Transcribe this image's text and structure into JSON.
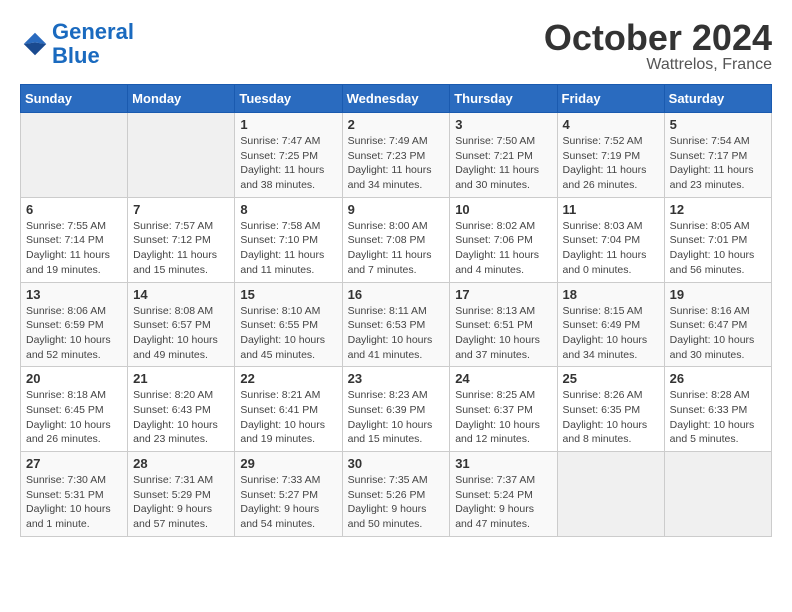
{
  "header": {
    "logo_line1": "General",
    "logo_line2": "Blue",
    "title": "October 2024",
    "subtitle": "Wattrelos, France"
  },
  "days_of_week": [
    "Sunday",
    "Monday",
    "Tuesday",
    "Wednesday",
    "Thursday",
    "Friday",
    "Saturday"
  ],
  "weeks": [
    [
      {
        "day": "",
        "info": ""
      },
      {
        "day": "",
        "info": ""
      },
      {
        "day": "1",
        "info": "Sunrise: 7:47 AM\nSunset: 7:25 PM\nDaylight: 11 hours and 38 minutes."
      },
      {
        "day": "2",
        "info": "Sunrise: 7:49 AM\nSunset: 7:23 PM\nDaylight: 11 hours and 34 minutes."
      },
      {
        "day": "3",
        "info": "Sunrise: 7:50 AM\nSunset: 7:21 PM\nDaylight: 11 hours and 30 minutes."
      },
      {
        "day": "4",
        "info": "Sunrise: 7:52 AM\nSunset: 7:19 PM\nDaylight: 11 hours and 26 minutes."
      },
      {
        "day": "5",
        "info": "Sunrise: 7:54 AM\nSunset: 7:17 PM\nDaylight: 11 hours and 23 minutes."
      }
    ],
    [
      {
        "day": "6",
        "info": "Sunrise: 7:55 AM\nSunset: 7:14 PM\nDaylight: 11 hours and 19 minutes."
      },
      {
        "day": "7",
        "info": "Sunrise: 7:57 AM\nSunset: 7:12 PM\nDaylight: 11 hours and 15 minutes."
      },
      {
        "day": "8",
        "info": "Sunrise: 7:58 AM\nSunset: 7:10 PM\nDaylight: 11 hours and 11 minutes."
      },
      {
        "day": "9",
        "info": "Sunrise: 8:00 AM\nSunset: 7:08 PM\nDaylight: 11 hours and 7 minutes."
      },
      {
        "day": "10",
        "info": "Sunrise: 8:02 AM\nSunset: 7:06 PM\nDaylight: 11 hours and 4 minutes."
      },
      {
        "day": "11",
        "info": "Sunrise: 8:03 AM\nSunset: 7:04 PM\nDaylight: 11 hours and 0 minutes."
      },
      {
        "day": "12",
        "info": "Sunrise: 8:05 AM\nSunset: 7:01 PM\nDaylight: 10 hours and 56 minutes."
      }
    ],
    [
      {
        "day": "13",
        "info": "Sunrise: 8:06 AM\nSunset: 6:59 PM\nDaylight: 10 hours and 52 minutes."
      },
      {
        "day": "14",
        "info": "Sunrise: 8:08 AM\nSunset: 6:57 PM\nDaylight: 10 hours and 49 minutes."
      },
      {
        "day": "15",
        "info": "Sunrise: 8:10 AM\nSunset: 6:55 PM\nDaylight: 10 hours and 45 minutes."
      },
      {
        "day": "16",
        "info": "Sunrise: 8:11 AM\nSunset: 6:53 PM\nDaylight: 10 hours and 41 minutes."
      },
      {
        "day": "17",
        "info": "Sunrise: 8:13 AM\nSunset: 6:51 PM\nDaylight: 10 hours and 37 minutes."
      },
      {
        "day": "18",
        "info": "Sunrise: 8:15 AM\nSunset: 6:49 PM\nDaylight: 10 hours and 34 minutes."
      },
      {
        "day": "19",
        "info": "Sunrise: 8:16 AM\nSunset: 6:47 PM\nDaylight: 10 hours and 30 minutes."
      }
    ],
    [
      {
        "day": "20",
        "info": "Sunrise: 8:18 AM\nSunset: 6:45 PM\nDaylight: 10 hours and 26 minutes."
      },
      {
        "day": "21",
        "info": "Sunrise: 8:20 AM\nSunset: 6:43 PM\nDaylight: 10 hours and 23 minutes."
      },
      {
        "day": "22",
        "info": "Sunrise: 8:21 AM\nSunset: 6:41 PM\nDaylight: 10 hours and 19 minutes."
      },
      {
        "day": "23",
        "info": "Sunrise: 8:23 AM\nSunset: 6:39 PM\nDaylight: 10 hours and 15 minutes."
      },
      {
        "day": "24",
        "info": "Sunrise: 8:25 AM\nSunset: 6:37 PM\nDaylight: 10 hours and 12 minutes."
      },
      {
        "day": "25",
        "info": "Sunrise: 8:26 AM\nSunset: 6:35 PM\nDaylight: 10 hours and 8 minutes."
      },
      {
        "day": "26",
        "info": "Sunrise: 8:28 AM\nSunset: 6:33 PM\nDaylight: 10 hours and 5 minutes."
      }
    ],
    [
      {
        "day": "27",
        "info": "Sunrise: 7:30 AM\nSunset: 5:31 PM\nDaylight: 10 hours and 1 minute."
      },
      {
        "day": "28",
        "info": "Sunrise: 7:31 AM\nSunset: 5:29 PM\nDaylight: 9 hours and 57 minutes."
      },
      {
        "day": "29",
        "info": "Sunrise: 7:33 AM\nSunset: 5:27 PM\nDaylight: 9 hours and 54 minutes."
      },
      {
        "day": "30",
        "info": "Sunrise: 7:35 AM\nSunset: 5:26 PM\nDaylight: 9 hours and 50 minutes."
      },
      {
        "day": "31",
        "info": "Sunrise: 7:37 AM\nSunset: 5:24 PM\nDaylight: 9 hours and 47 minutes."
      },
      {
        "day": "",
        "info": ""
      },
      {
        "day": "",
        "info": ""
      }
    ]
  ]
}
